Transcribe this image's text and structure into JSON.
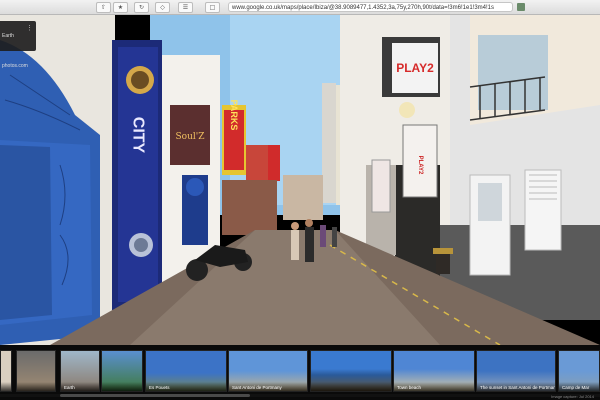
{
  "browser": {
    "url": "www.google.co.uk/maps/place/Ibiza/@38.9089477,1.4352,3a,75y,270h,90t/data=!3m6!1e1!3m4!1s"
  },
  "panorama": {
    "signs": {
      "city_sign": "CITY",
      "red_sign": "PARKS",
      "play2_top": "PLAY2",
      "play2_small": "PLAY2",
      "shop_sign": "Soul'Z"
    }
  },
  "info_card": {
    "text": "Earth photos.com"
  },
  "filmstrip": {
    "thumbnails": [
      {
        "caption": ""
      },
      {
        "caption": ""
      },
      {
        "caption": "Earth"
      },
      {
        "caption": ""
      },
      {
        "caption": "Es Pouets"
      },
      {
        "caption": "Sant Antoni de Portmany"
      },
      {
        "caption": ""
      },
      {
        "caption": "Town beach"
      },
      {
        "caption": "The sunset in Sant Antoni de Portmany"
      },
      {
        "caption": "Camp de Mar"
      }
    ],
    "footnote": "Image capture: Jul 2014"
  }
}
